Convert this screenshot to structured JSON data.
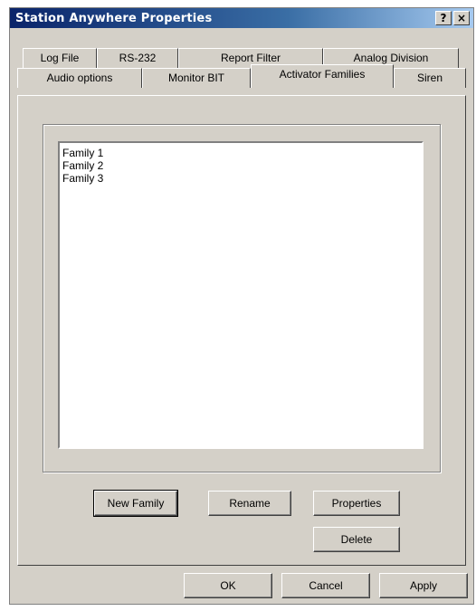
{
  "window": {
    "title": "Station Anywhere Properties",
    "help_button": "?",
    "close_button": "×"
  },
  "tabs": {
    "row_back": [
      "Log File",
      "RS-232",
      "Report Filter",
      "Analog Division"
    ],
    "row_front": [
      "Audio options",
      "Monitor BIT",
      "Activator Families",
      "Siren"
    ],
    "active": "Activator Families"
  },
  "families": {
    "items": [
      "Family 1",
      "Family 2",
      "Family 3"
    ]
  },
  "actions": {
    "new_family": "New Family",
    "rename": "Rename",
    "properties": "Properties",
    "delete": "Delete"
  },
  "dialog": {
    "ok": "OK",
    "cancel": "Cancel",
    "apply": "Apply"
  },
  "colors": {
    "title_gradient_start": "#0a246a",
    "dialog_face": "#d4d0c8"
  }
}
